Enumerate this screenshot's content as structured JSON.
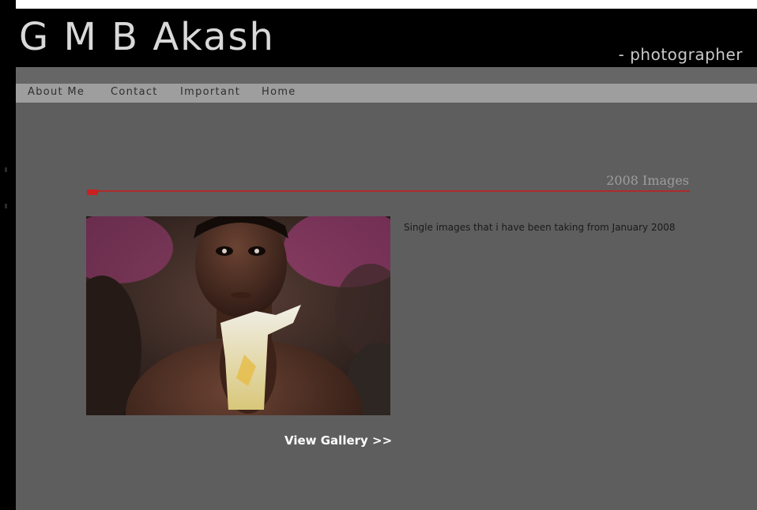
{
  "header": {
    "site_title": "G M B Akash",
    "tagline": "- photographer"
  },
  "nav": {
    "items": [
      {
        "label": "About Me"
      },
      {
        "label": "Contact"
      },
      {
        "label": "Important"
      },
      {
        "label": "Home"
      }
    ]
  },
  "section": {
    "title": "2008 Images",
    "description": "Single images that i have been taking from January 2008",
    "gallery_link": "View Gallery >>"
  },
  "image": {
    "subject": "boy holding food wrapper"
  },
  "colors": {
    "accent": "#cc1f1f",
    "background": "#5e5e5e",
    "nav_bar": "#9e9e9e",
    "header": "#000000"
  }
}
